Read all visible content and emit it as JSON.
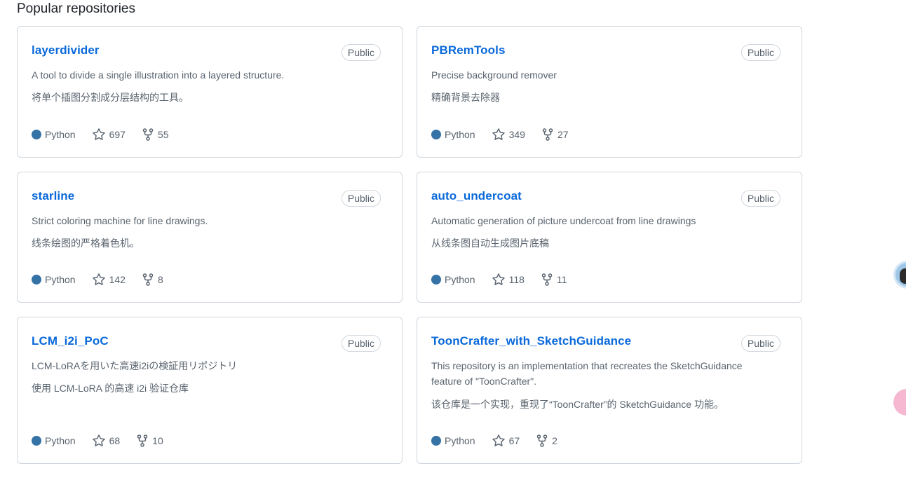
{
  "section": {
    "title": "Popular repositories"
  },
  "colors": {
    "link": "#0969da",
    "python": "#3572A5",
    "muted": "#59636e",
    "border": "#d0d7de"
  },
  "repos": [
    {
      "name": "layerdivider",
      "visibility": "Public",
      "description_en": "A tool to divide a single illustration into a layered structure.",
      "description_zh": "将单个插图分割成分层结构的工具。",
      "language": "Python",
      "stars": "697",
      "forks": "55"
    },
    {
      "name": "PBRemTools",
      "visibility": "Public",
      "description_en": "Precise background remover",
      "description_zh": "精确背景去除器",
      "language": "Python",
      "stars": "349",
      "forks": "27"
    },
    {
      "name": "starline",
      "visibility": "Public",
      "description_en": "Strict coloring machine for line drawings.",
      "description_zh": "线条绘图的严格着色机。",
      "language": "Python",
      "stars": "142",
      "forks": "8"
    },
    {
      "name": "auto_undercoat",
      "visibility": "Public",
      "description_en": "Automatic generation of picture undercoat from line drawings",
      "description_zh": "从线条图自动生成图片底稿",
      "language": "Python",
      "stars": "118",
      "forks": "11"
    },
    {
      "name": "LCM_i2i_PoC",
      "visibility": "Public",
      "description_en": "LCM-LoRAを用いた高速i2iの検証用リポジトリ",
      "description_zh": "使用 LCM-LoRA 的高速 i2i 验证仓库",
      "language": "Python",
      "stars": "68",
      "forks": "10"
    },
    {
      "name": "ToonCrafter_with_SketchGuidance",
      "visibility": "Public",
      "description_en": "This repository is an implementation that recreates the SketchGuidance feature of \"ToonCrafter\".",
      "description_zh": "该仓库是一个实现，重现了“ToonCrafter”的 SketchGuidance 功能。",
      "language": "Python",
      "stars": "67",
      "forks": "2"
    }
  ]
}
